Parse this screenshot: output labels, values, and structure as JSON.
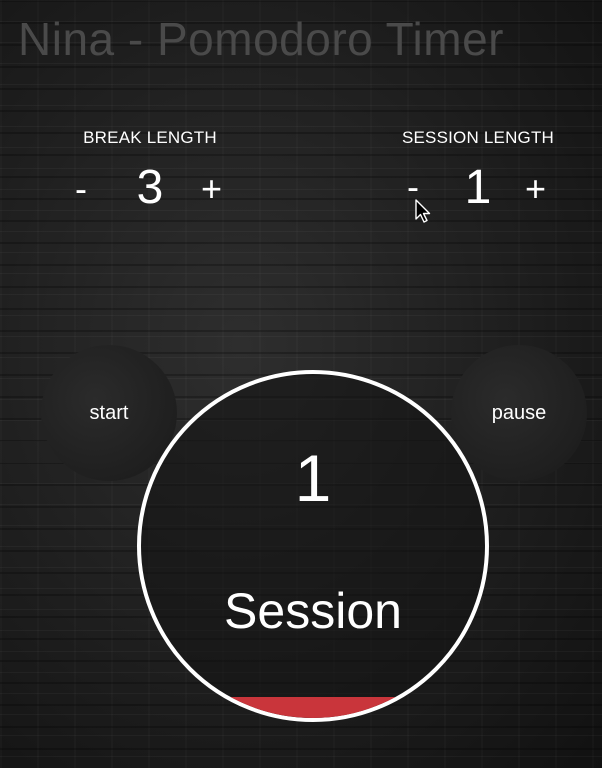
{
  "app": {
    "title": "Nina - Pomodoro Timer"
  },
  "break": {
    "label": "BREAK LENGTH",
    "minus": "-",
    "value": "3",
    "plus": "+"
  },
  "session": {
    "label": "SESSION LENGTH",
    "minus": "-",
    "value": "1",
    "plus": "+"
  },
  "controls": {
    "start": "start",
    "pause": "pause"
  },
  "timer": {
    "count": "1",
    "label": "Session",
    "progress_percent": 6
  },
  "colors": {
    "fill": "#c9353b",
    "ring": "#ffffff",
    "title": "#4a4a4a"
  },
  "icons": {
    "cursor": "mouse-pointer-icon"
  }
}
